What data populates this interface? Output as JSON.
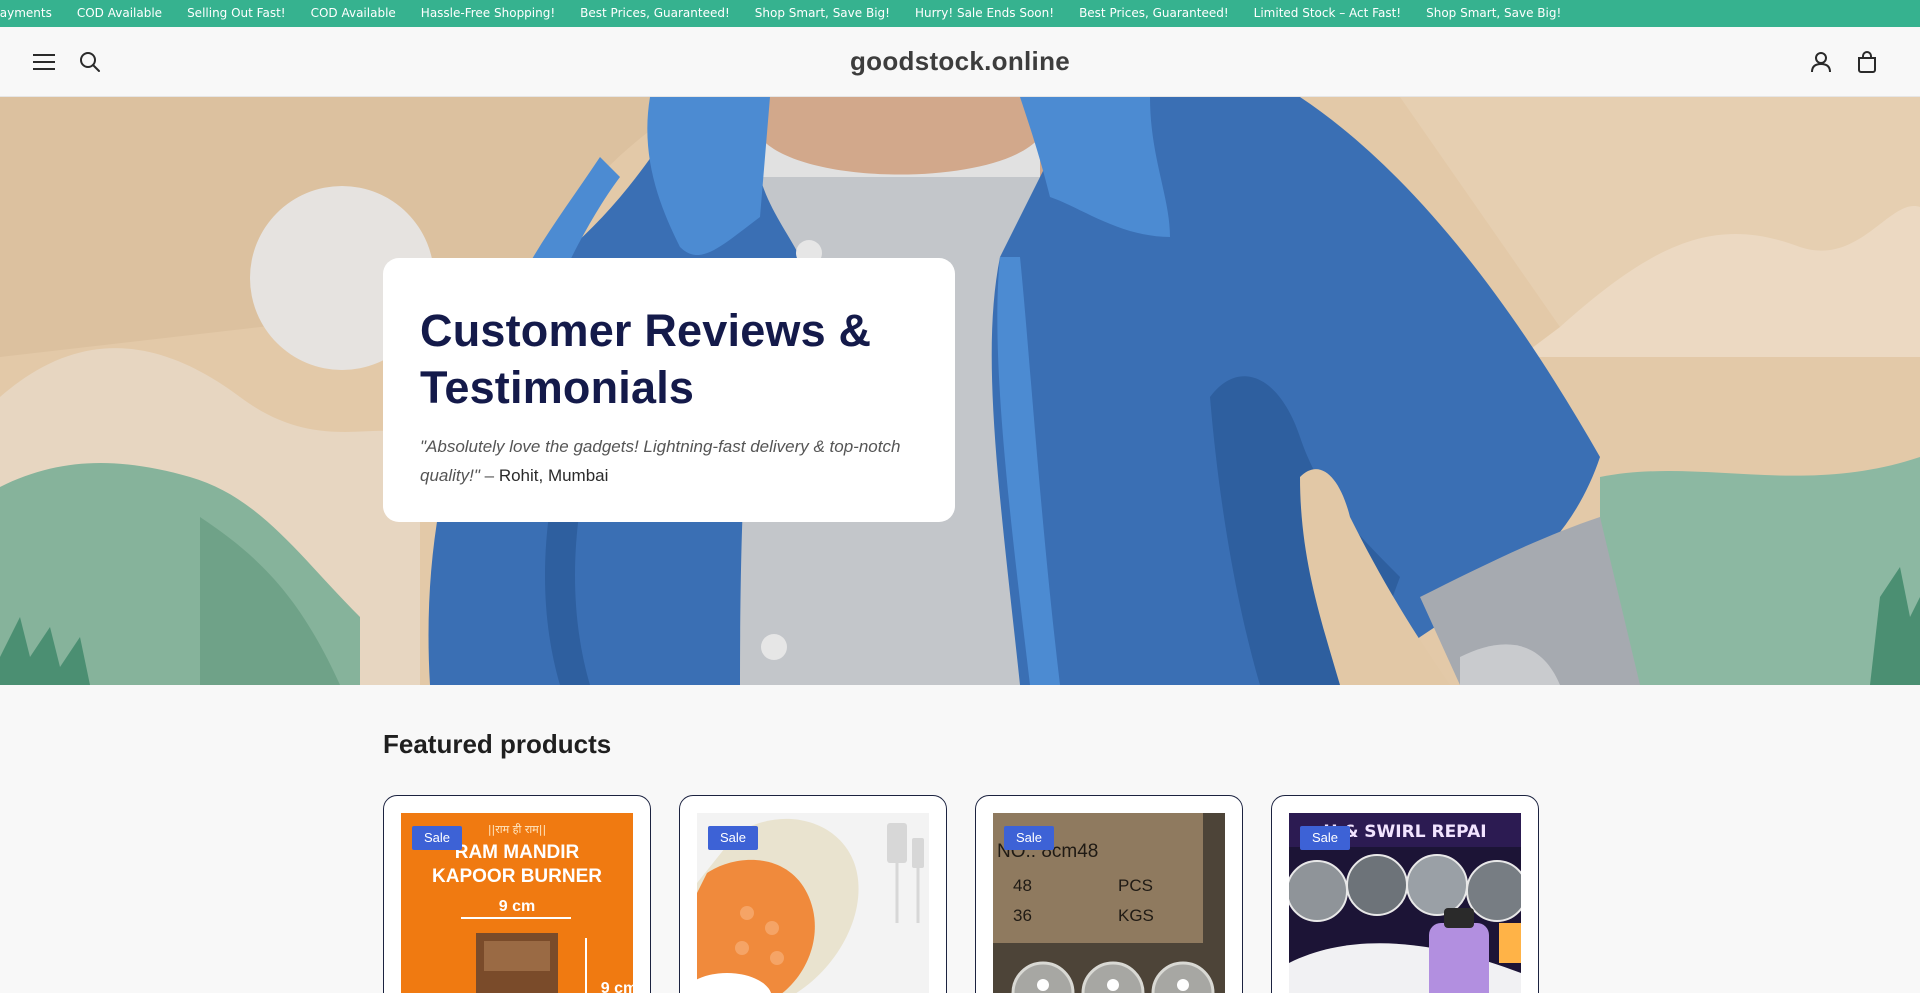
{
  "announcement": {
    "items": [
      "Secure Payments",
      "COD Available",
      "Selling Out Fast!",
      "COD Available",
      "Hassle-Free Shopping!",
      "Best Prices, Guaranteed!",
      "Shop Smart, Save Big!",
      "Hurry! Sale Ends Soon!",
      "Best Prices, Guaranteed!",
      "Limited Stock – Act Fast!",
      "Shop Smart, Save Big!"
    ]
  },
  "header": {
    "logo": "goodstock.online",
    "icons": {
      "menu": "menu-icon",
      "search": "search-icon",
      "account": "user-icon",
      "cart": "cart-icon"
    }
  },
  "hero": {
    "title": "Customer Reviews & Testimonials",
    "quote": "\"Absolutely love the gadgets! Lightning-fast delivery & top-notch quality!\"",
    "dash": " – ",
    "author": "Rohit, Mumbai"
  },
  "featured": {
    "title": "Featured products",
    "products": [
      {
        "badge": "Sale",
        "image_text_top": "||राम ही राम||",
        "image_text_main": "RAM MANDIR KAPOOR BURNER",
        "image_dim_1": "9 cm",
        "image_dim_2": "9 cm"
      },
      {
        "badge": "Sale"
      },
      {
        "badge": "Sale",
        "image_text_main": "NO.: 8cm48",
        "image_text_2": "48",
        "image_text_3": "PCS",
        "image_text_4": "36",
        "image_text_5": "KGS"
      },
      {
        "badge": "Sale",
        "image_text_main": "H & SWIRL REPAI"
      }
    ]
  },
  "colors": {
    "ticker_bg": "#36b28f",
    "badge_bg": "#3d62d6",
    "hero_title": "#141a4a"
  }
}
